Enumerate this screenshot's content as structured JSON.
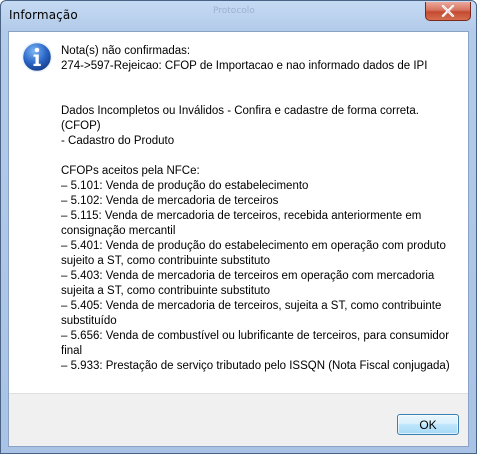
{
  "window": {
    "title": "Informação",
    "background_ghost_text": "Protocolo",
    "close_icon": "close-icon"
  },
  "message": {
    "icon": "info-icon",
    "text": "Nota(s) não confirmadas:\n274->597-Rejeicao: CFOP de Importacao e nao informado dados de IPI\n\n\nDados Incompletos ou Inválidos - Confira e cadastre de forma correta.\n(CFOP)\n- Cadastro do Produto\n\n CFOPs aceitos pela NFCe:\n– 5.101: Venda de produção do estabelecimento\n– 5.102: Venda de mercadoria de terceiros\n– 5.115: Venda de mercadoria de terceiros, recebida anteriormente em\nconsignação mercantil\n– 5.401: Venda de produção do estabelecimento em operação com produto\nsujeito a ST, como contribuinte substituto\n– 5.403: Venda de mercadoria de terceiros em operação com mercadoria\nsujeita a ST, como contribuinte substituto\n– 5.405: Venda de mercadoria de terceiros, sujeita a ST, como contribuinte\nsubstituído\n– 5.656: Venda de combustível ou lubrificante de terceiros, para consumidor\nfinal\n– 5.933: Prestação de serviço tributado pelo ISSQN (Nota Fiscal conjugada)"
  },
  "footer": {
    "ok_label": "OK"
  },
  "colors": {
    "title_bar": "#b3cbea",
    "close_button": "#c44a31",
    "icon_blue": "#2a66c6",
    "ok_border": "#3c7fb1"
  }
}
